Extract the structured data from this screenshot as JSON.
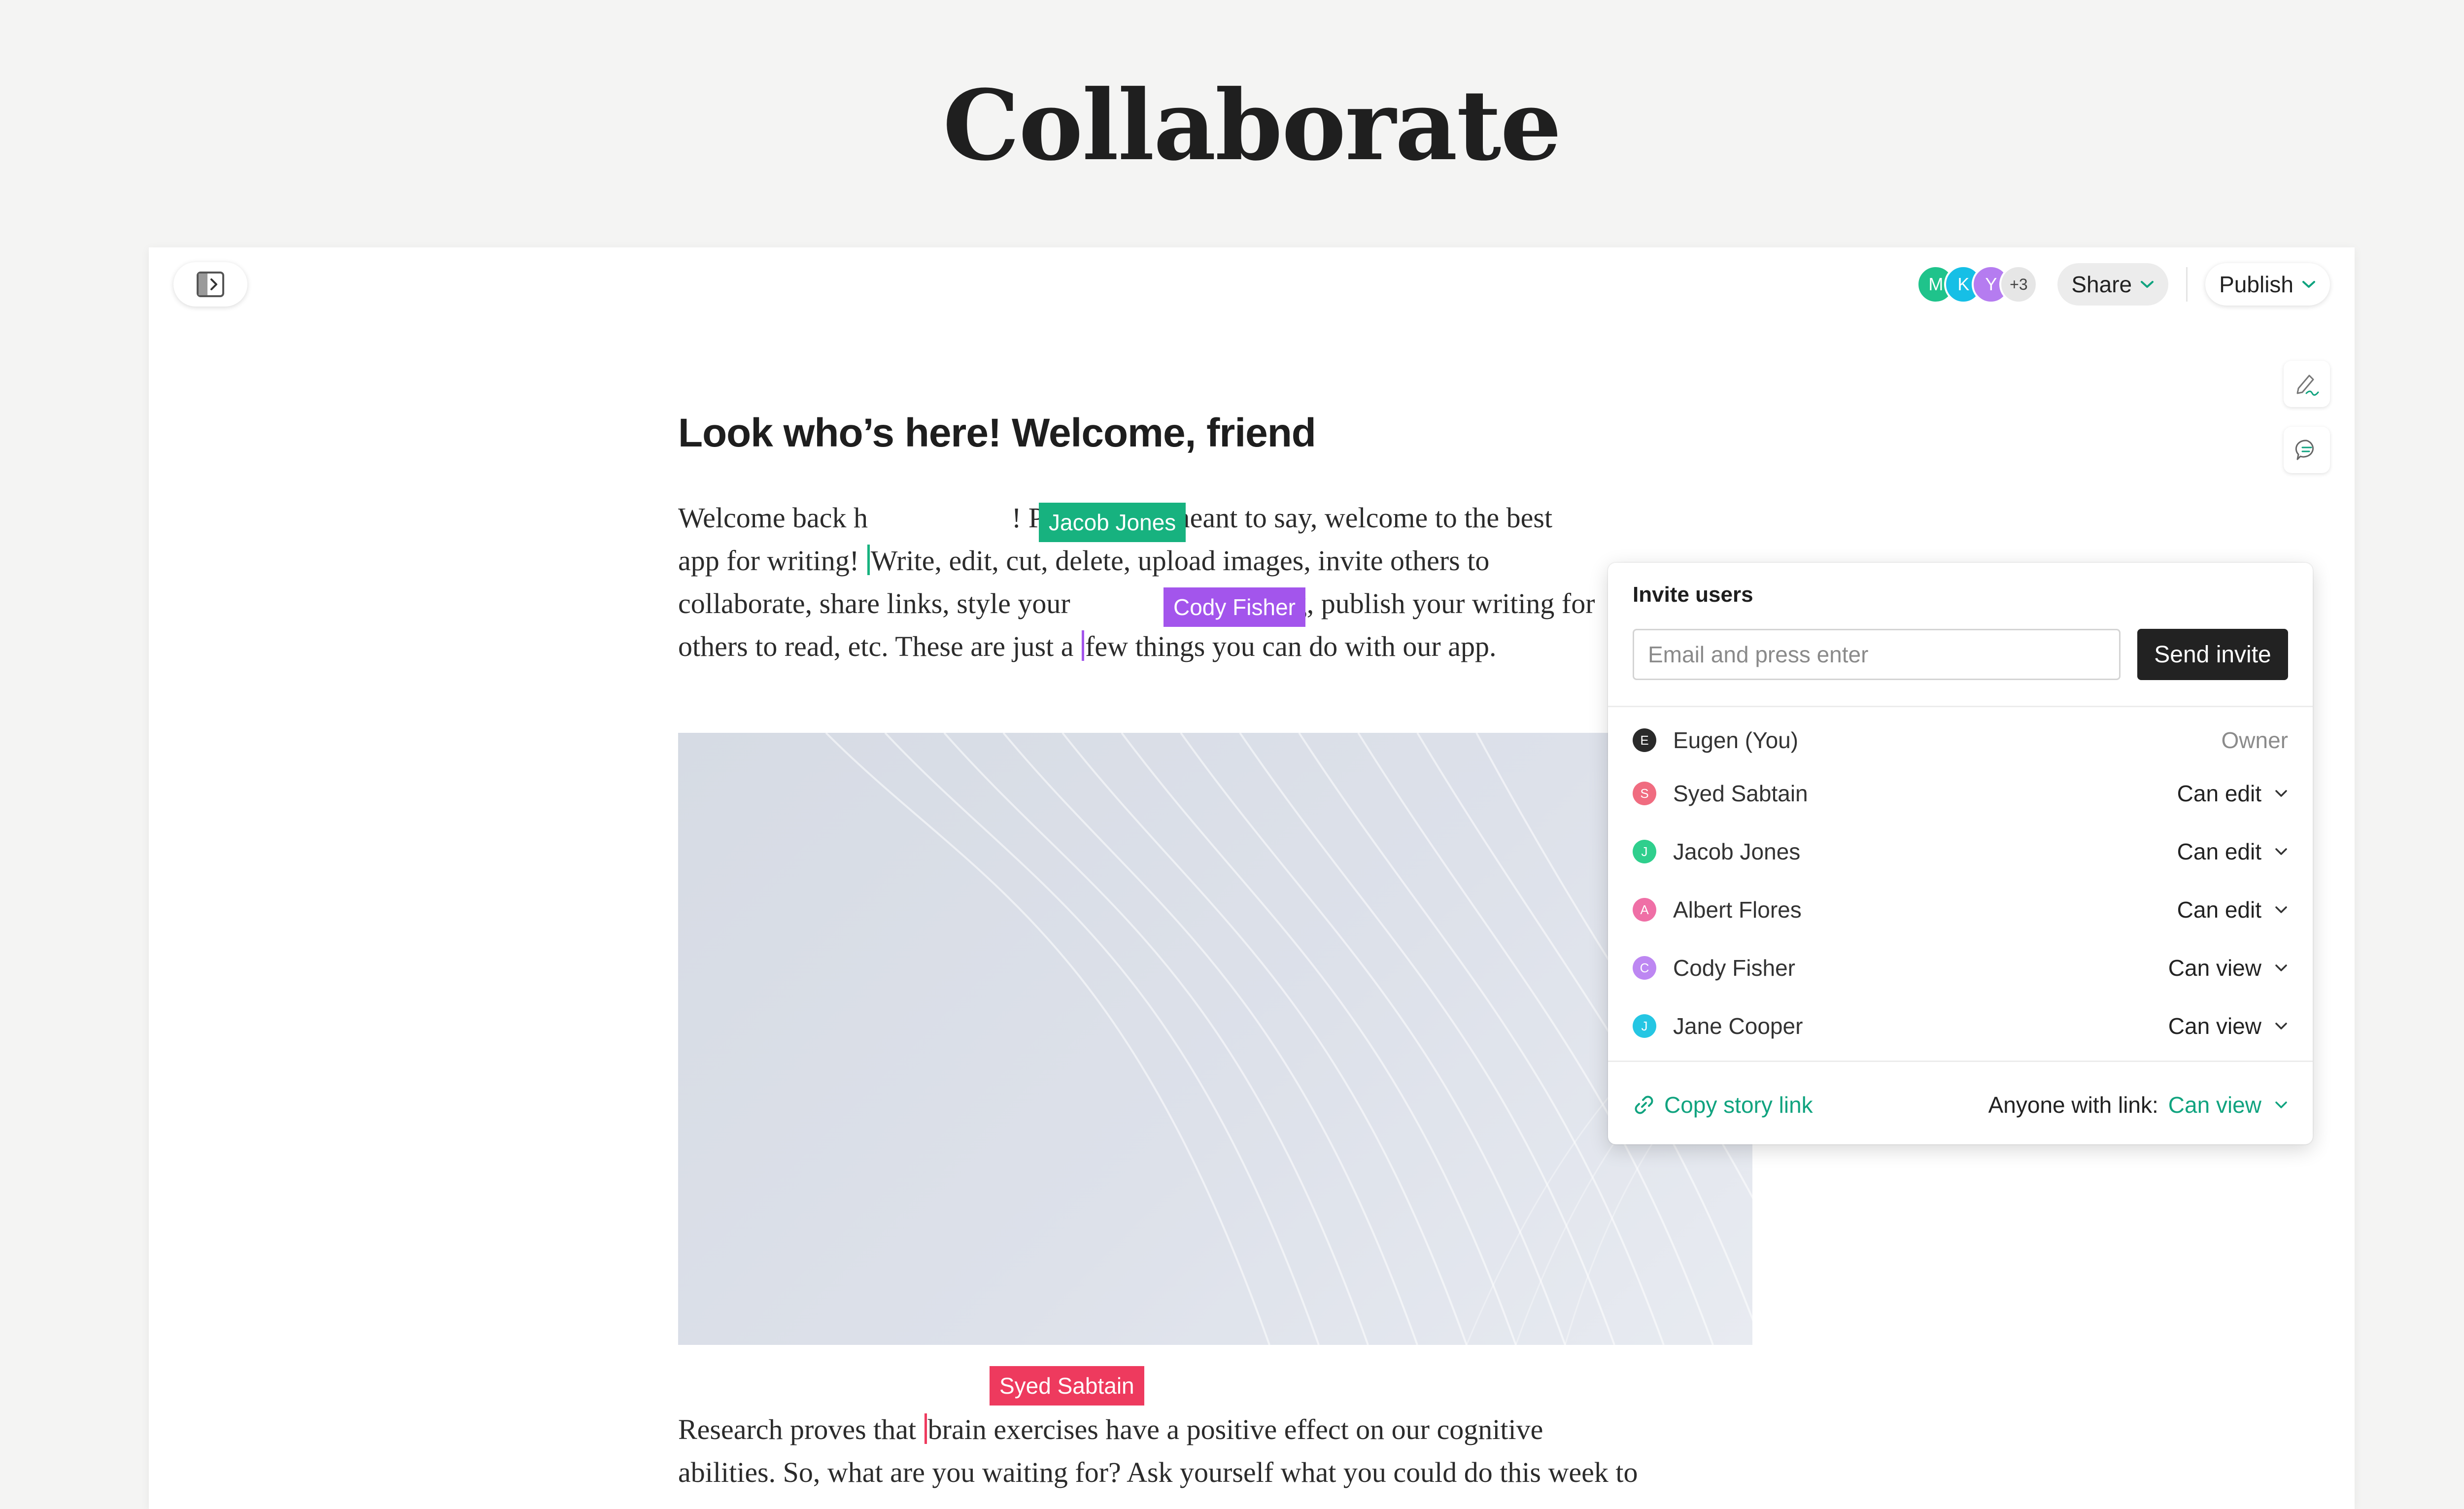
{
  "page": {
    "title": "Collaborate"
  },
  "toolbar": {
    "avatars": [
      {
        "initial": "M",
        "color": "#1fc38b"
      },
      {
        "initial": "K",
        "color": "#16bfe6"
      },
      {
        "initial": "Y",
        "color": "#b57cf0"
      }
    ],
    "avatars_more": "+3",
    "share_label": "Share",
    "publish_label": "Publish"
  },
  "article": {
    "heading": "Look who’s here! Welcome, friend",
    "paragraph1": {
      "line1_a": "Welcome back h",
      "line1_b": "! Pardon. We meant to say, welcome to the best",
      "line2_a": "app for writing! ",
      "line2_b": "Write, edit, cut, delete, upload images, invite others to",
      "line3_a": "collaborate, share links, style your ",
      "line3_b": "e a blog, publish your writing for",
      "line4_a": "others to read, etc. These are just a ",
      "line4_b": "few things you can do with our app."
    },
    "paragraph2": {
      "line1_a": "Research proves that ",
      "line1_b": "brain exercises have a positive effect on our cognitive",
      "line2": "abilities. So, what are you waiting for? Ask yourself what you could do this week to"
    }
  },
  "cursors": {
    "jacob": {
      "name": "Jacob Jones",
      "color": "#17b27f"
    },
    "cody": {
      "name": "Cody Fisher",
      "color": "#a355ec"
    },
    "syed": {
      "name": "Syed Sabtain",
      "color": "#ee3a5e"
    }
  },
  "share_popover": {
    "title": "Invite users",
    "email_placeholder": "Email and press enter",
    "send_label": "Send invite",
    "users": [
      {
        "initial": "E",
        "name": "Eugen (You)",
        "role": "Owner",
        "color": "#2a2a2a"
      },
      {
        "initial": "S",
        "name": "Syed Sabtain",
        "role": "Can edit",
        "color": "#f06c80"
      },
      {
        "initial": "J",
        "name": "Jacob Jones",
        "role": "Can edit",
        "color": "#2fcf8d"
      },
      {
        "initial": "A",
        "name": "Albert Flores",
        "role": "Can edit",
        "color": "#ef6fa6"
      },
      {
        "initial": "C",
        "name": "Cody Fisher",
        "role": "Can view",
        "color": "#bd87f2"
      },
      {
        "initial": "J",
        "name": "Jane Cooper",
        "role": "Can view",
        "color": "#25c6e3"
      }
    ],
    "copy_link_label": "Copy story link",
    "anyone_label": "Anyone with link:",
    "anyone_value": "Can view"
  },
  "colors": {
    "accent": "#10a37f",
    "dark_button": "#222222"
  },
  "icons": [
    "sidebar-toggle-icon",
    "chevron-down-icon",
    "pen-signature-icon",
    "comment-icon",
    "link-icon"
  ]
}
